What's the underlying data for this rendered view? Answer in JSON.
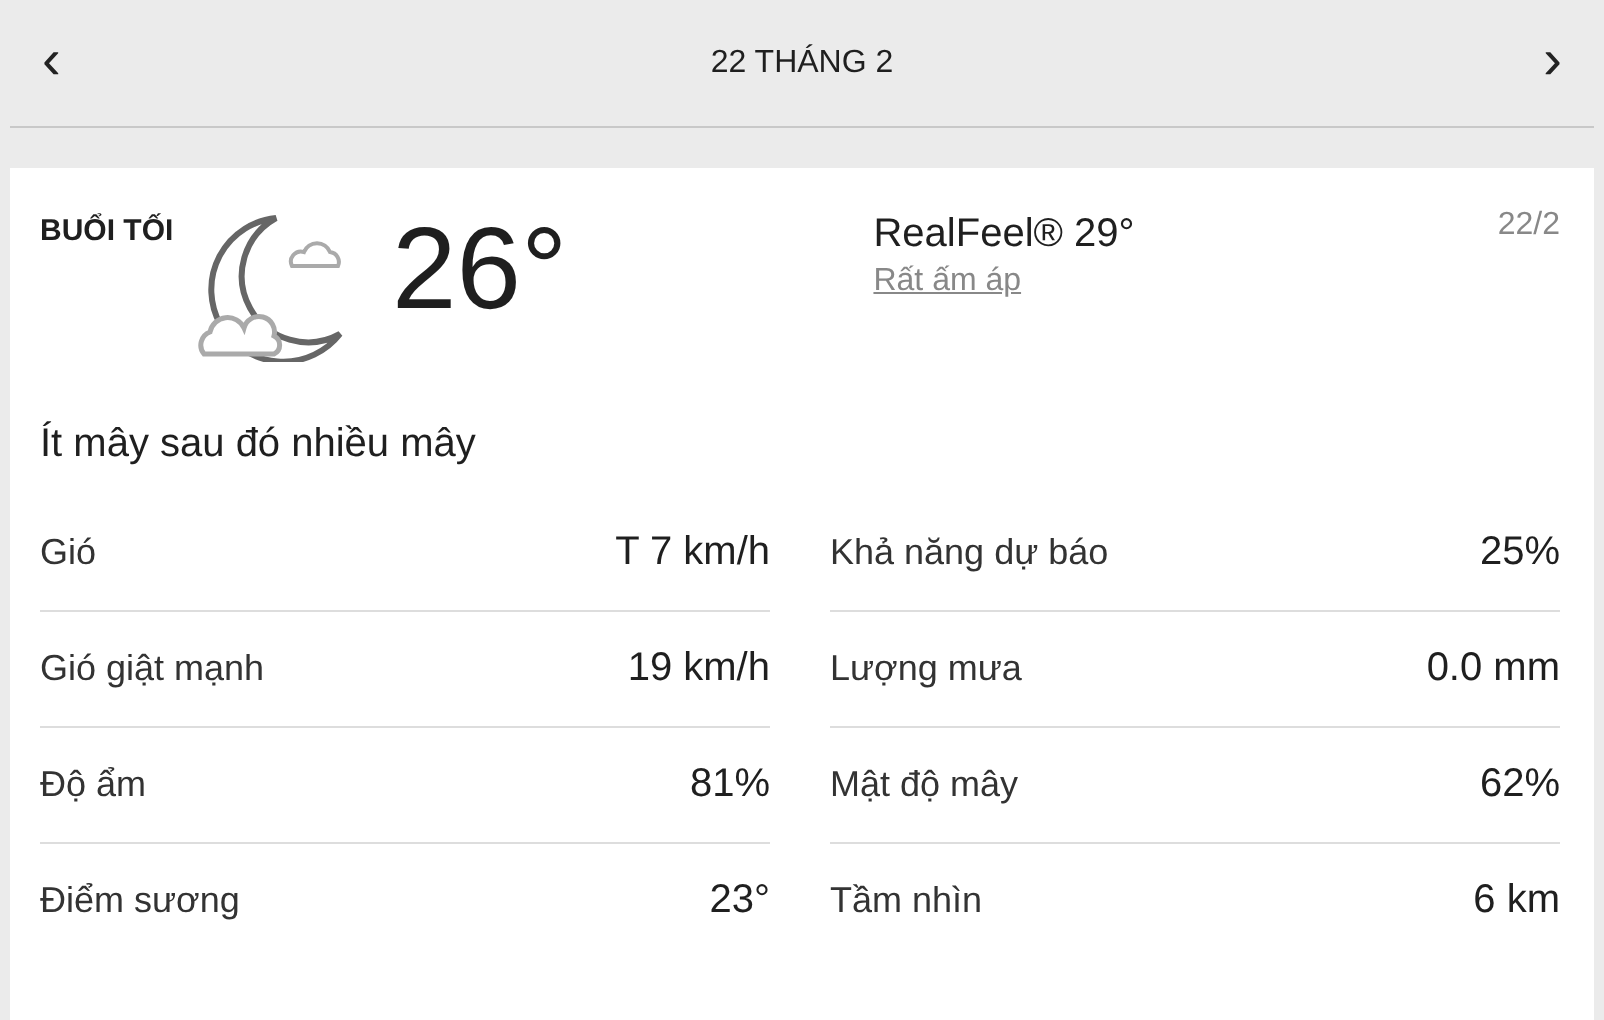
{
  "header": {
    "prev": "‹",
    "title": "22 THÁNG 2",
    "next": "›"
  },
  "card": {
    "period": "BUỔI TỐI",
    "temperature": "26°",
    "realfeel": "RealFeel® 29°",
    "feel_phrase": "Rất ấm áp",
    "date": "22/2",
    "description": "Ít mây sau đó nhiều mây"
  },
  "left_details": [
    {
      "label": "Gió",
      "value": "T 7 km/h"
    },
    {
      "label": "Gió giật mạnh",
      "value": "19 km/h"
    },
    {
      "label": "Độ ẩm",
      "value": "81%"
    },
    {
      "label": "Điểm sương",
      "value": "23°"
    }
  ],
  "right_details": [
    {
      "label": "Khả năng dự báo",
      "value": "25%"
    },
    {
      "label": "Lượng mưa",
      "value": "0.0 mm"
    },
    {
      "label": "Mật độ mây",
      "value": "62%"
    },
    {
      "label": "Tầm nhìn",
      "value": "6 km"
    }
  ]
}
